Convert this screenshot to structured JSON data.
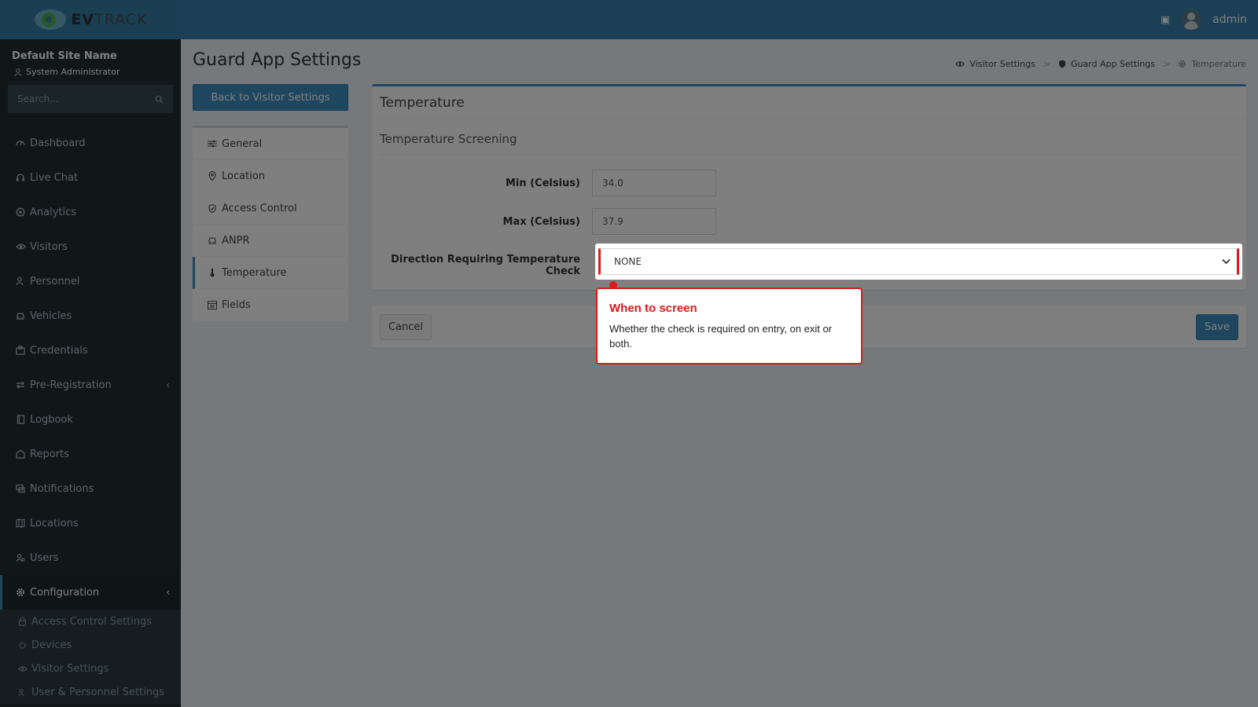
{
  "header": {
    "logo_prefix": "EV",
    "logo_suffix": "TRACK",
    "user_name": "admin"
  },
  "sidebar": {
    "site_name": "Default Site Name",
    "role": "System Administrator",
    "search_placeholder": "Search...",
    "items": [
      {
        "label": "Dashboard",
        "icon": "dashboard-icon"
      },
      {
        "label": "Live Chat",
        "icon": "headset-icon"
      },
      {
        "label": "Analytics",
        "icon": "analytics-icon"
      },
      {
        "label": "Visitors",
        "icon": "eye-icon"
      },
      {
        "label": "Personnel",
        "icon": "personnel-icon"
      },
      {
        "label": "Vehicles",
        "icon": "car-icon"
      },
      {
        "label": "Credentials",
        "icon": "credentials-icon"
      },
      {
        "label": "Pre-Registration",
        "icon": "swap-icon"
      },
      {
        "label": "Logbook",
        "icon": "book-icon"
      },
      {
        "label": "Reports",
        "icon": "reports-icon"
      },
      {
        "label": "Notifications",
        "icon": "chat-icon"
      },
      {
        "label": "Locations",
        "icon": "map-icon"
      },
      {
        "label": "Users",
        "icon": "users-icon"
      },
      {
        "label": "Configuration",
        "icon": "gear-icon"
      }
    ],
    "sub_items": [
      {
        "label": "Access Control Settings",
        "icon": "lock-icon"
      },
      {
        "label": "Devices",
        "icon": "device-icon"
      },
      {
        "label": "Visitor Settings",
        "icon": "eye-icon"
      },
      {
        "label": "User & Personnel Settings",
        "icon": "users-icon"
      }
    ]
  },
  "page": {
    "title": "Guard App Settings",
    "breadcrumb": [
      "Visitor Settings",
      "Guard App Settings",
      "Temperature"
    ],
    "back_button": "Back to Visitor Settings"
  },
  "settings_menu": [
    {
      "label": "General",
      "icon": "sliders-icon"
    },
    {
      "label": "Location",
      "icon": "pin-icon"
    },
    {
      "label": "Access Control",
      "icon": "shield-icon"
    },
    {
      "label": "ANPR",
      "icon": "car-icon"
    },
    {
      "label": "Temperature",
      "icon": "thermometer-icon"
    },
    {
      "label": "Fields",
      "icon": "fields-icon"
    }
  ],
  "form": {
    "box_title": "Temperature",
    "section_title": "Temperature Screening",
    "min_label": "Min (Celsius)",
    "min_value": "34.0",
    "max_label": "Max (Celsius)",
    "max_value": "37.9",
    "direction_label": "Direction Requiring Temperature Check",
    "direction_value": "NONE",
    "cancel_label": "Cancel",
    "save_label": "Save"
  },
  "tooltip": {
    "title": "When to screen",
    "text": "Whether the check is required on entry, on exit or both."
  },
  "colors": {
    "header": "#367fa9",
    "sidebar": "#222d32",
    "accent": "#3c8dbc",
    "highlight": "#dd1a1a"
  }
}
